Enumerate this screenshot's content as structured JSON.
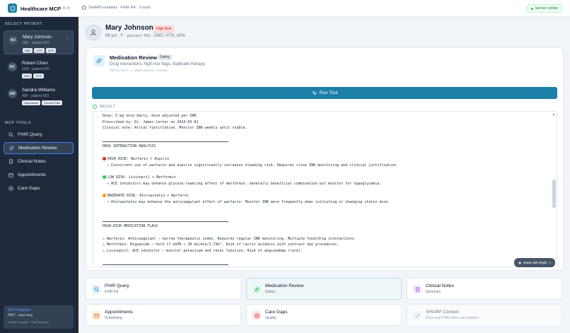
{
  "app": {
    "title": "Healthcare MCP",
    "version": "v1.0.0",
    "status": "SHARP-enabled · FHIR R4 · 5 tools",
    "server_status": "Server online"
  },
  "sidebar": {
    "patients_heading": "SELECT PATIENT",
    "patients": [
      {
        "initials": "MJ",
        "name": "Mary Johnson",
        "meta": "68F · patient-001",
        "tags": [
          "DM2",
          "HTN",
          "AFib"
        ]
      },
      {
        "initials": "RC",
        "name": "Robert Chen",
        "meta": "52M · patient-002",
        "tags": [
          "DM2",
          "HTN"
        ]
      },
      {
        "initials": "SW",
        "name": "Sandra Williams",
        "meta": "40F · patient-003",
        "tags": [
          "Depression",
          "Chronic Pain"
        ]
      }
    ],
    "tools_heading": "MCP TOOLS",
    "tools": [
      {
        "label": "FHIR Query",
        "icon": "search-icon"
      },
      {
        "label": "Medication Review",
        "icon": "pill-icon"
      },
      {
        "label": "Clinical Notes",
        "icon": "document-icon"
      },
      {
        "label": "Appointments",
        "icon": "calendar-icon"
      },
      {
        "label": "Care Gaps",
        "icon": "target-icon"
      }
    ],
    "endpoint": {
      "title": "MCP Endpoint",
      "path": "POST /api/mcp",
      "sub": "SHARP headers · SSE transport"
    }
  },
  "patient_header": {
    "name": "Mary Johnson",
    "risk": "High Risk",
    "meta_prefix": "68 y/o · F ·",
    "patient_id": "patient-001",
    "meta_suffix": "· DM2, HTN, AFib"
  },
  "tool_panel": {
    "title": "Medication Review",
    "badge": "Safety",
    "subtitle": "Drug interactions, high-risk flags, duplicate therapy",
    "call": "tools/call → medication_review",
    "run_label": "Run Tool",
    "result_label": "RESULT",
    "result_lines": {
      "l1": "Dose: 5 mg once daily, dose adjusted per INR",
      "l2": "Prescribed by: Dr. James Carter on 2024-03-01",
      "l3": "Clinical note: Atrial fibrillation. Monitor INR weekly until stable.",
      "l4": "DRUG INTERACTION ANALYSIS",
      "l5": "HIGH RISK: Warfarin + Aspirin",
      "l6": "  → Concurrent use of warfarin and aspirin significantly increases bleeding risk. Requires close INR monitoring and clinical justification.",
      "l7": "LOW RISK: Lisinopril + Metformin",
      "l8": "  → ACE inhibitors may enhance glucose-lowering effect of metformin. Generally beneficial combination but monitor for hypoglycemia.",
      "l9": "MODERATE RISK: Atorvastatin + Warfarin",
      "l10": "  → Atorvastatin may enhance the anticoagulant effect of warfarin. Monitor INR more frequently when initiating or changing statin dose.",
      "l11": "HIGH-RISK MEDICATION FLAGS",
      "l12": "⚠ Warfarin: Anticoagulant — narrow therapeutic index. Requires regular INR monitoring. Multiple food/drug interactions.",
      "l13": "⚠ Metformin: Biguanide — hold if eGFR < 30 mL/min/1.73m². Risk of lactic acidosis with contrast dye procedures.",
      "l14": "⚠ Lisinopril: ACE inhibitor — monitor potassium and renal function. Risk of angioedema (rare)."
    },
    "risk_colors": {
      "high": "#dc2626",
      "low": "#22c55e",
      "moderate": "#f59e0b"
    },
    "made_with": "Made with Replit"
  },
  "cards": [
    {
      "title": "FHIR Query",
      "sub": "FHIR R4",
      "icon": "search-icon"
    },
    {
      "title": "Medication Review",
      "sub": "Safety",
      "icon": "pill-icon"
    },
    {
      "title": "Clinical Notes",
      "sub": "Summary",
      "icon": "document-icon"
    },
    {
      "title": "Appointments",
      "sub": "Scheduling",
      "icon": "calendar-icon"
    },
    {
      "title": "Care Gaps",
      "sub": "Quality",
      "icon": "target-icon"
    },
    {
      "title": "SHARP Context",
      "sub": "Pass real FHIR token via headers",
      "icon": "link-icon"
    }
  ],
  "colors": {
    "accent": "#1d7fa8",
    "sidebar": "#1e293b",
    "risk": "#b91c1c"
  }
}
